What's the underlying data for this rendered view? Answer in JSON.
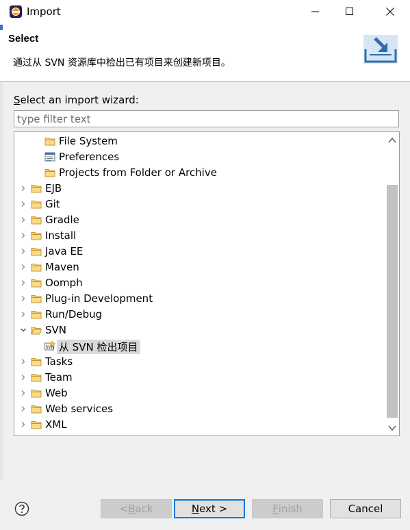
{
  "window": {
    "title": "Import",
    "minimize_icon": "minimize-icon",
    "maximize_icon": "maximize-icon",
    "close_icon": "close-icon"
  },
  "header": {
    "title": "Select",
    "description": "通过从 SVN 资源库中检出已有项目来创建新项目。",
    "banner_icon": "import-wizard-banner-icon"
  },
  "wizard": {
    "label": "Select an import wizard:",
    "mnemonic": "S",
    "filter_placeholder": "type filter text",
    "tree": [
      {
        "label": "File System",
        "level": 1,
        "icon": "folder-icon",
        "expandable": false
      },
      {
        "label": "Preferences",
        "level": 1,
        "icon": "preferences-icon",
        "expandable": false
      },
      {
        "label": "Projects from Folder or Archive",
        "level": 1,
        "icon": "folder-icon",
        "expandable": false
      },
      {
        "label": "EJB",
        "level": 0,
        "icon": "folder-icon",
        "expandable": true,
        "expanded": false
      },
      {
        "label": "Git",
        "level": 0,
        "icon": "folder-icon",
        "expandable": true,
        "expanded": false
      },
      {
        "label": "Gradle",
        "level": 0,
        "icon": "folder-icon",
        "expandable": true,
        "expanded": false
      },
      {
        "label": "Install",
        "level": 0,
        "icon": "folder-icon",
        "expandable": true,
        "expanded": false
      },
      {
        "label": "Java EE",
        "level": 0,
        "icon": "folder-icon",
        "expandable": true,
        "expanded": false
      },
      {
        "label": "Maven",
        "level": 0,
        "icon": "folder-icon",
        "expandable": true,
        "expanded": false
      },
      {
        "label": "Oomph",
        "level": 0,
        "icon": "folder-icon",
        "expandable": true,
        "expanded": false
      },
      {
        "label": "Plug-in Development",
        "level": 0,
        "icon": "folder-icon",
        "expandable": true,
        "expanded": false
      },
      {
        "label": "Run/Debug",
        "level": 0,
        "icon": "folder-icon",
        "expandable": true,
        "expanded": false
      },
      {
        "label": "SVN",
        "level": 0,
        "icon": "folder-open-icon",
        "expandable": true,
        "expanded": true
      },
      {
        "label": "从 SVN 检出项目",
        "level": 1,
        "icon": "svn-checkout-icon",
        "expandable": false,
        "selected": true
      },
      {
        "label": "Tasks",
        "level": 0,
        "icon": "folder-icon",
        "expandable": true,
        "expanded": false
      },
      {
        "label": "Team",
        "level": 0,
        "icon": "folder-icon",
        "expandable": true,
        "expanded": false
      },
      {
        "label": "Web",
        "level": 0,
        "icon": "folder-icon",
        "expandable": true,
        "expanded": false
      },
      {
        "label": "Web services",
        "level": 0,
        "icon": "folder-icon",
        "expandable": true,
        "expanded": false
      },
      {
        "label": "XML",
        "level": 0,
        "icon": "folder-icon",
        "expandable": true,
        "expanded": false
      }
    ],
    "scroll_position": 0.2
  },
  "buttons": {
    "back": {
      "label": "< Back",
      "enabled": false
    },
    "next": {
      "label": "Next >",
      "enabled": true,
      "default": true
    },
    "finish": {
      "label": "Finish",
      "enabled": false
    },
    "cancel": {
      "label": "Cancel",
      "enabled": true
    }
  },
  "colors": {
    "dialog_bg": "#f0f0f0",
    "header_bg": "#ffffff",
    "folder": "#e8b84a",
    "default_button_border": "#0078d7",
    "selection_bg": "#d9d9d9"
  }
}
